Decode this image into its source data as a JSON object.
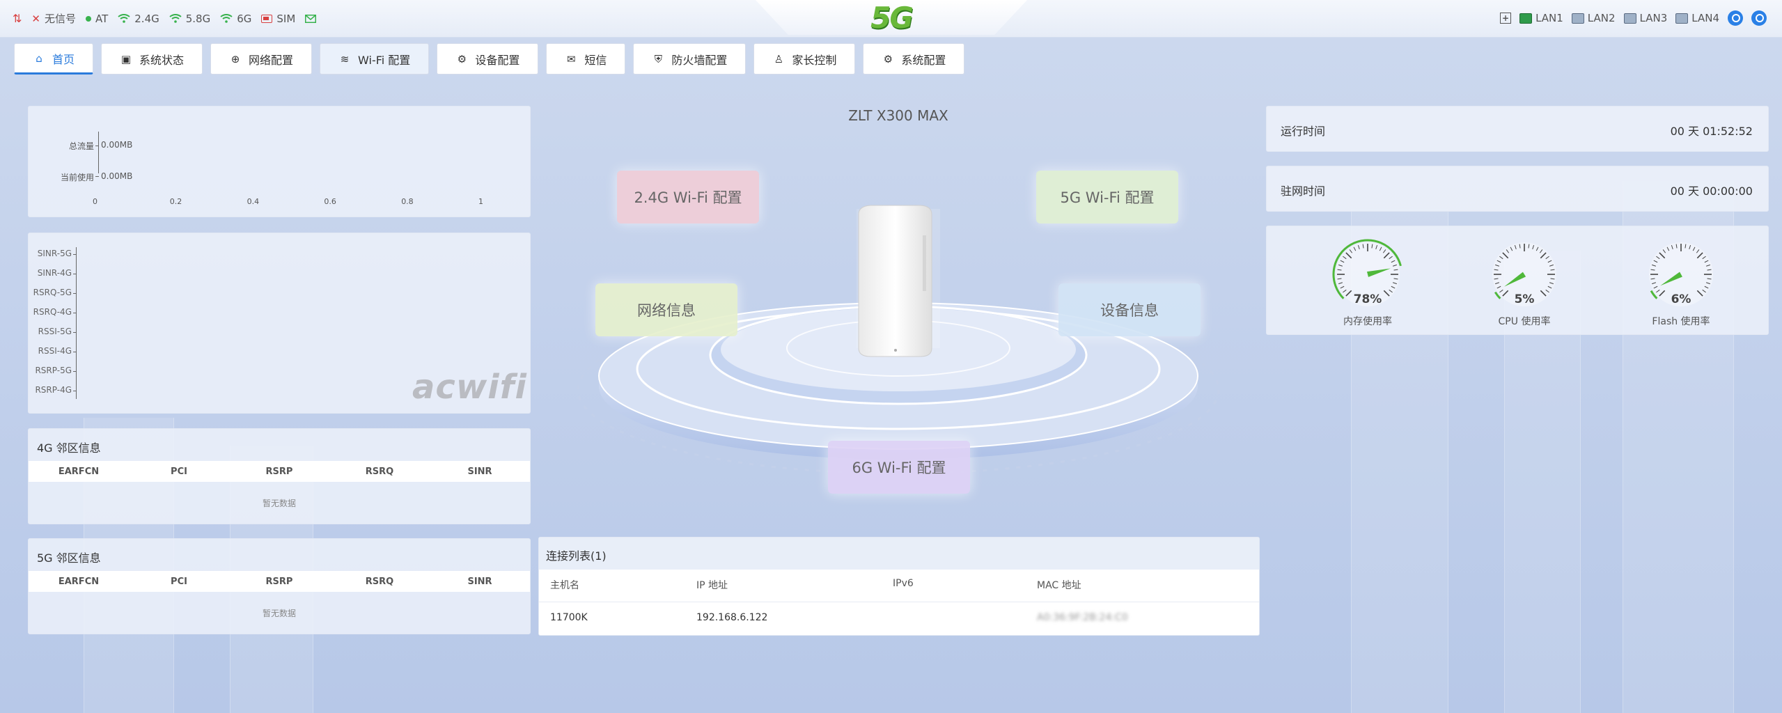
{
  "status": {
    "signal_text": "无信号",
    "at_text": "AT",
    "wifi_24": "2.4G",
    "wifi_58": "5.8G",
    "wifi_6": "6G",
    "sim_text": "SIM",
    "logo": "5G",
    "lans": [
      "LAN1",
      "LAN2",
      "LAN3",
      "LAN4"
    ]
  },
  "nav": {
    "tabs": [
      {
        "label": "首页",
        "icon": "home-icon",
        "glyph": "⌂"
      },
      {
        "label": "系统状态",
        "icon": "chart-icon",
        "glyph": "▣"
      },
      {
        "label": "网络配置",
        "icon": "globe-icon",
        "glyph": "⊕"
      },
      {
        "label": "Wi-Fi 配置",
        "icon": "wifi-icon",
        "glyph": "≋"
      },
      {
        "label": "设备配置",
        "icon": "gear-icon",
        "glyph": "⚙"
      },
      {
        "label": "短信",
        "icon": "mail-icon",
        "glyph": "✉"
      },
      {
        "label": "防火墙配置",
        "icon": "shield-icon",
        "glyph": "⛨"
      },
      {
        "label": "家长控制",
        "icon": "parent-icon",
        "glyph": "♙"
      },
      {
        "label": "系统配置",
        "icon": "settings-icon",
        "glyph": "⚙"
      }
    ]
  },
  "traffic": {
    "chart_data": {
      "type": "bar",
      "orientation": "horizontal",
      "categories": [
        "总流量",
        "当前使用"
      ],
      "values": [
        0,
        0
      ],
      "value_labels": [
        "0.00MB",
        "0.00MB"
      ],
      "xticks": [
        "0",
        "0.2",
        "0.4",
        "0.6",
        "0.8",
        "1"
      ],
      "xlim": [
        0,
        1
      ]
    }
  },
  "signal": {
    "chart_data": {
      "type": "bar",
      "orientation": "horizontal",
      "categories": [
        "SINR-5G",
        "SINR-4G",
        "RSRQ-5G",
        "RSRQ-4G",
        "RSSI-5G",
        "RSSI-4G",
        "RSRP-5G",
        "RSRP-4G"
      ],
      "values": []
    },
    "watermark": "acwifi"
  },
  "neighbor4g": {
    "title": "4G 邻区信息",
    "columns": [
      "EARFCN",
      "PCI",
      "RSRP",
      "RSRQ",
      "SINR"
    ],
    "empty": "暂无数据"
  },
  "neighbor5g": {
    "title": "5G 邻区信息",
    "columns": [
      "EARFCN",
      "PCI",
      "RSRP",
      "RSRQ",
      "SINR"
    ],
    "empty": "暂无数据"
  },
  "center": {
    "model": "ZLT X300 MAX",
    "cards": {
      "wifi24": "2.4G Wi-Fi 配置",
      "wifi5": "5G Wi-Fi 配置",
      "network": "网络信息",
      "device": "设备信息",
      "wifi6": "6G Wi-Fi 配置"
    }
  },
  "runtime": {
    "label": "运行时间",
    "value": "00 天 01:52:52"
  },
  "camp": {
    "label": "驻网时间",
    "value": "00 天 00:00:00"
  },
  "gauges": [
    {
      "label": "内存使用率",
      "value_text": "78%",
      "percent": 78
    },
    {
      "label": "CPU 使用率",
      "value_text": "5%",
      "percent": 5
    },
    {
      "label": "Flash 使用率",
      "value_text": "6%",
      "percent": 6
    }
  ],
  "colors": {
    "accent": "#2a7bdc",
    "gauge_green": "#4fb83a",
    "alert_red": "#d84040"
  },
  "connections": {
    "title": "连接列表(1)",
    "columns": [
      "主机名",
      "IP 地址",
      "IPv6",
      "MAC 地址"
    ],
    "rows": [
      {
        "host": "11700K",
        "ip": "192.168.6.122",
        "ipv6": "",
        "mac": "A0:36:9F:2B:24:C0"
      }
    ]
  }
}
